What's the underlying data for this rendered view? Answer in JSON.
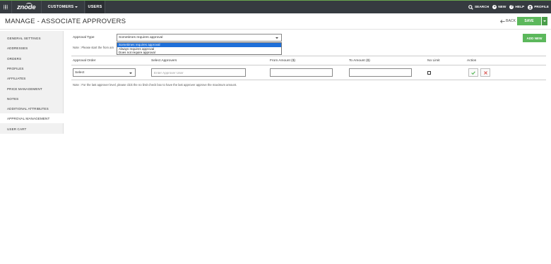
{
  "topnav": {
    "logo": "znode",
    "tabs": [
      {
        "label": "CUSTOMERS",
        "has_caret": true
      },
      {
        "label": "USERS",
        "active": true
      }
    ],
    "actions": [
      {
        "label": "SEARCH",
        "icon": "search-icon"
      },
      {
        "label": "NEW",
        "icon": "plus-circle-icon"
      },
      {
        "label": "HELP",
        "icon": "help-icon"
      },
      {
        "label": "PROFILE",
        "icon": "user-icon"
      }
    ]
  },
  "header": {
    "title": "MANAGE  - ASSOCIATE APPROVERS",
    "back_label": "BACK",
    "save_label": "SAVE"
  },
  "sidebar": {
    "items": [
      {
        "label": "GENERAL SETTINGS"
      },
      {
        "label": "ADDRESSES"
      },
      {
        "label": "ORDERS"
      },
      {
        "label": "PROFILES"
      },
      {
        "label": "AFFILIATES"
      },
      {
        "label": "PRICE MANAGEMENT"
      },
      {
        "label": "NOTES"
      },
      {
        "label": "ADDITIONAL ATTRIBUTES"
      },
      {
        "label": "APPROVAL MANAGEMENT",
        "active": true
      },
      {
        "label": "USER CART"
      }
    ]
  },
  "approval": {
    "type_label": "Approval Type",
    "type_value": "Sometimes requires approval",
    "options": [
      "Sometimes requires approval",
      "Always requires approval",
      "Does not require approval"
    ],
    "selected_index": 0,
    "note_top": "Note : Please start the from am",
    "add_new_label": "ADD NEW"
  },
  "table": {
    "headers": [
      "Approval Order",
      "Select Approvers",
      "From Amount ($)",
      "To Amount ($)",
      "No Limit",
      "Action"
    ],
    "row": {
      "order_value": "Select",
      "approver_placeholder": "Enter Approver User",
      "from_amount": "",
      "to_amount": ""
    },
    "note_bottom": "Note : For the last approver level, please click the no limit check box to have the last approver approve the maximum amount."
  },
  "colors": {
    "topbar": "#363b40",
    "accent_green": "#5cb85c",
    "danger_red": "#d9534f",
    "selection_blue": "#1e6fd9"
  }
}
